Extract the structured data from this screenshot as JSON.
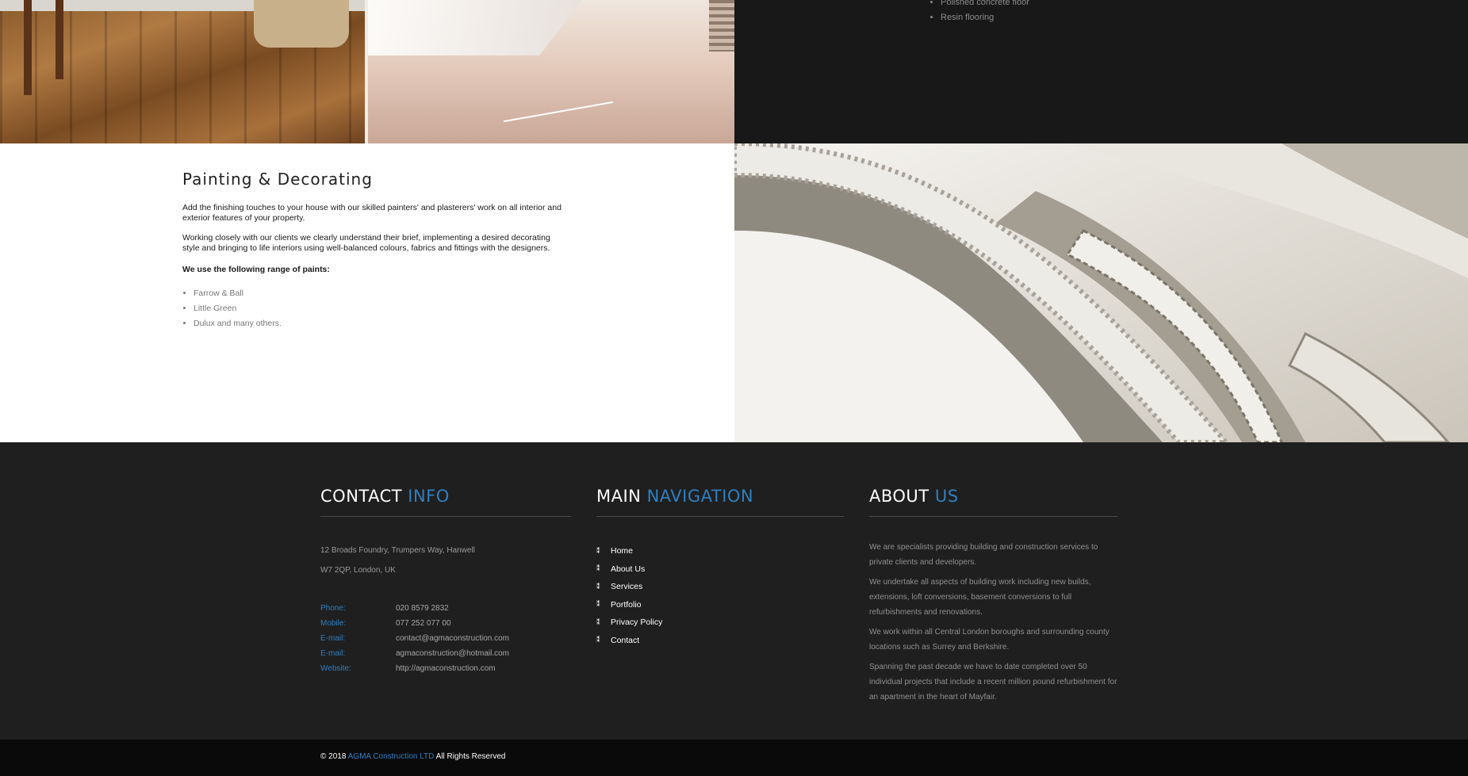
{
  "top": {
    "flooring_list": [
      "Polished concrete floor",
      "Resin flooring"
    ]
  },
  "painting": {
    "title": "Painting & Decorating",
    "p1": "Add the finishing touches to your house with our skilled painters' and plasterers' work on all interior and exterior features of your property.",
    "p2": "Working closely with our clients we clearly understand their brief, implementing a desired decorating style and bringing to life interiors using well-balanced colours, fabrics and fittings with the designers.",
    "p3": "We use the following range of  paints:",
    "paints": [
      "Farrow & Ball",
      "Little Green",
      "Dulux and many others."
    ]
  },
  "footer": {
    "contact": {
      "title_main": "CONTACT",
      "title_accent": "INFO",
      "address_line1": "12 Broads Foundry, Trumpers Way, Hanwell",
      "address_line2": "W7 2QP, London, UK",
      "rows": [
        {
          "label": "Phone:",
          "value": "020 8579 2832"
        },
        {
          "label": "Mobile:",
          "value": "077 252 077 00"
        },
        {
          "label": "E-mail:",
          "value": "contact@agmaconstruction.com"
        },
        {
          "label": "E-mail:",
          "value": "agmaconstruction@hotmail.com"
        },
        {
          "label": "Website:",
          "value": "http://agmaconstruction.com"
        }
      ]
    },
    "navigation": {
      "title_main": "MAIN",
      "title_accent": "NAVIGATION",
      "items": [
        "Home",
        "About Us",
        "Services",
        "Portfolio",
        "Privacy Policy",
        "Contact"
      ]
    },
    "about": {
      "title_main": "ABOUT",
      "title_accent": "US",
      "paragraphs": [
        "We are specialists providing building and construction services to private clients and developers.",
        "We undertake all aspects of building work including new builds, extensions, loft conversions, basement conversions to full refurbishments and renovations.",
        "We work within all Central London boroughs and surrounding county locations such as Surrey and Berkshire.",
        "Spanning the past decade we have to date completed over 50 individual projects that include a recent million pound refurbishment for an apartment in the heart of Mayfair."
      ]
    },
    "copyright": {
      "prefix": "© 2018",
      "company": "AGMA Construction LTD",
      "suffix": "All Rights Reserved"
    }
  },
  "colors": {
    "accent": "#2f7fc1",
    "footer_bg": "#1f1f1f",
    "bottom_bar_bg": "#0a0a0a"
  }
}
